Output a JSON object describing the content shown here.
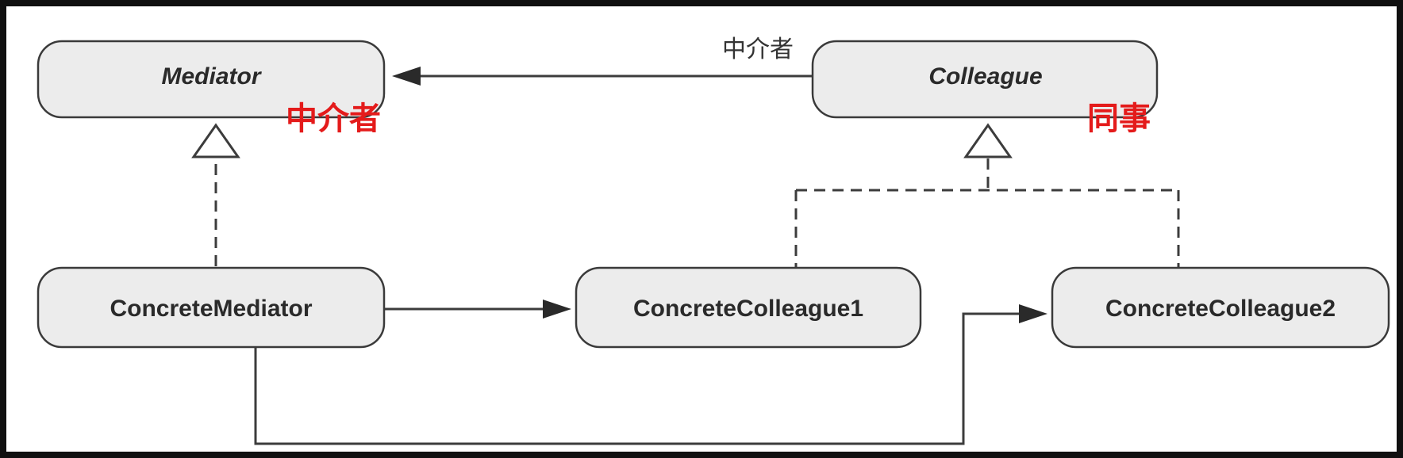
{
  "diagram": {
    "nodes": {
      "mediator": {
        "label": "Mediator",
        "annotation": "中介者"
      },
      "colleague": {
        "label": "Colleague",
        "annotation": "同事"
      },
      "concrete_mediator": {
        "label": "ConcreteMediator"
      },
      "concrete_colleague1": {
        "label": "ConcreteColleague1"
      },
      "concrete_colleague2": {
        "label": "ConcreteColleague2"
      }
    },
    "edges": {
      "colleague_to_mediator": {
        "from": "colleague",
        "to": "mediator",
        "kind": "association",
        "label": "中介者"
      },
      "concrete_mediator_realizes_mediator": {
        "from": "concrete_mediator",
        "to": "mediator",
        "kind": "realization"
      },
      "concrete_colleagues_realize_colleague": {
        "from": [
          "concrete_colleague1",
          "concrete_colleague2"
        ],
        "to": "colleague",
        "kind": "realization"
      },
      "concrete_mediator_to_colleague1": {
        "from": "concrete_mediator",
        "to": "concrete_colleague1",
        "kind": "association"
      },
      "concrete_mediator_to_colleague2": {
        "from": "concrete_mediator",
        "to": "concrete_colleague2",
        "kind": "association"
      }
    },
    "colors": {
      "annotation": "#e41b1b",
      "node_fill": "#ececec",
      "stroke": "#3a3a3a"
    }
  }
}
